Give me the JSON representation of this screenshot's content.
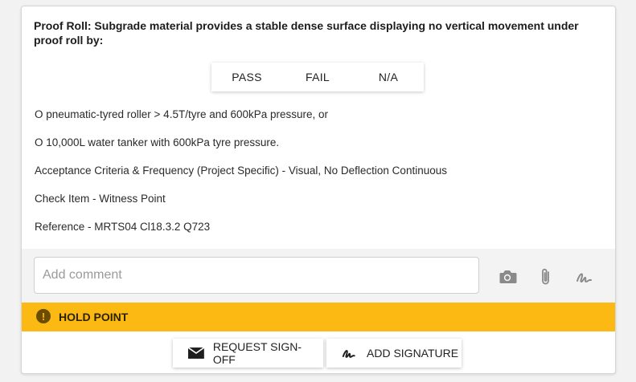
{
  "question": {
    "text": "Proof Roll: Subgrade material provides a stable dense surface displaying no vertical movement under proof roll by:"
  },
  "choices": [
    "PASS",
    "FAIL",
    "N/A"
  ],
  "details": {
    "option1": "O pneumatic-tyred roller > 4.5T/tyre and 600kPa pressure, or",
    "option2": "O 10,000L water tanker with 600kPa tyre pressure.",
    "acceptance": "Acceptance Criteria & Frequency (Project Specific) - Visual, No Deflection Continuous",
    "check_item": "Check Item - Witness Point",
    "reference": "Reference - MRTS04 Cl18.3.2 Q723"
  },
  "comment": {
    "placeholder": "Add comment",
    "value": ""
  },
  "icons": {
    "camera": "camera-icon",
    "attachment": "paperclip-icon",
    "signature": "signature-icon"
  },
  "hold_point": {
    "label": "HOLD POINT",
    "color": "#fdb913"
  },
  "actions": {
    "request_signoff": "REQUEST SIGN-OFF",
    "add_signature": "ADD SIGNATURE"
  }
}
